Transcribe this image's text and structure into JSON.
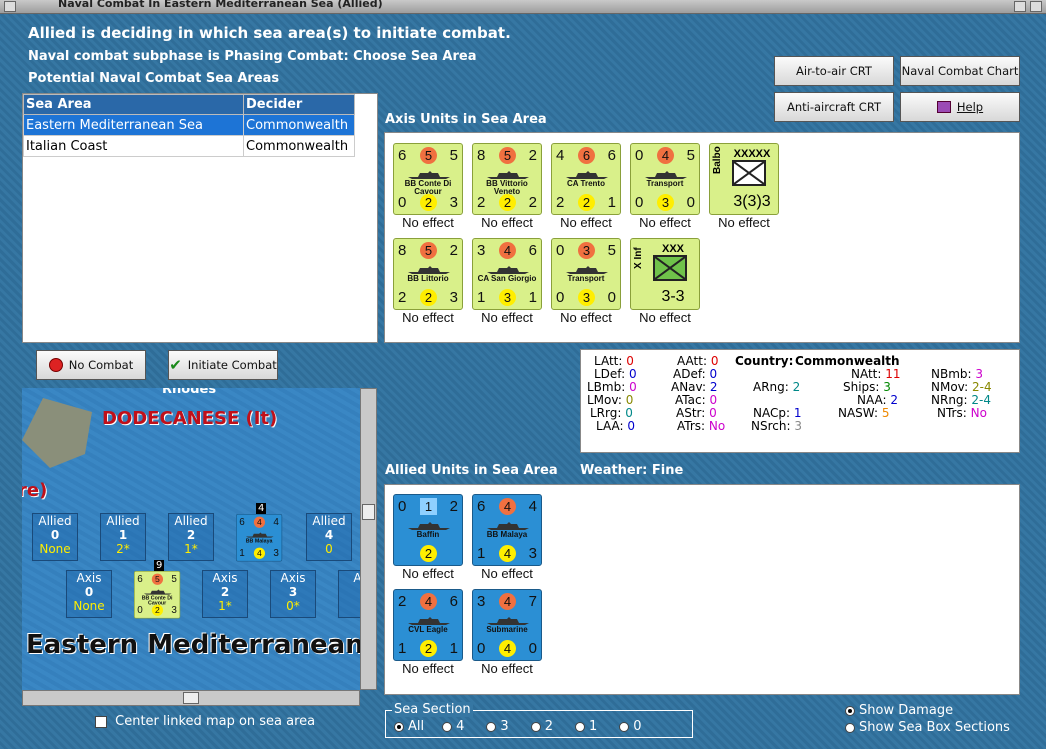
{
  "window": {
    "title": "Naval Combat In Eastern Mediterranean Sea (Allied)"
  },
  "messages": {
    "line1": "Allied is deciding in which sea area(s) to initiate combat.",
    "line2": "Naval combat subphase is Phasing Combat: Choose Sea Area",
    "line3": "Potential Naval Combat Sea Areas"
  },
  "sea_table": {
    "headers": [
      "Sea Area",
      "Decider"
    ],
    "rows": [
      {
        "area": "Eastern Mediterranean Sea",
        "decider": "Commonwealth"
      },
      {
        "area": "Italian Coast",
        "decider": "Commonwealth"
      }
    ]
  },
  "buttons": {
    "air_to_air": "Air-to-air CRT",
    "naval_chart": "Naval Combat Chart",
    "anti_aircraft": "Anti-aircraft CRT",
    "help": "Help",
    "no_combat": "No Combat",
    "initiate": "Initiate Combat"
  },
  "axis_section": {
    "label": "Axis Units in Sea Area"
  },
  "allied_section": {
    "label": "Allied Units in Sea Area",
    "weather": "Weather:  Fine"
  },
  "axis_units": [
    {
      "tl": "6",
      "red": "5",
      "tr": "5",
      "name": "BB Conte Di Cavour",
      "bl": "0",
      "yel": "2",
      "br": "3",
      "effect": "No effect"
    },
    {
      "tl": "8",
      "red": "5",
      "tr": "2",
      "name": "BB Vittorio Veneto",
      "bl": "2",
      "yel": "2",
      "br": "2",
      "effect": "No effect"
    },
    {
      "tl": "4",
      "red": "6",
      "tr": "6",
      "name": "CA Trento",
      "bl": "2",
      "yel": "2",
      "br": "1",
      "effect": "No effect"
    },
    {
      "tl": "0",
      "red": "4",
      "tr": "5",
      "name": "Transport",
      "bl": "0",
      "yel": "3",
      "br": "0",
      "effect": "No effect"
    },
    {
      "top": "XXXXX",
      "side": "Balbo",
      "val": "3(3)3",
      "effect": "No effect"
    },
    {
      "tl": "8",
      "red": "5",
      "tr": "2",
      "name": "BB Littorio",
      "bl": "2",
      "yel": "2",
      "br": "3",
      "effect": "No effect"
    },
    {
      "tl": "3",
      "red": "4",
      "tr": "6",
      "name": "CA San Giorgio",
      "bl": "1",
      "yel": "3",
      "br": "1",
      "effect": "No effect"
    },
    {
      "tl": "0",
      "red": "3",
      "tr": "5",
      "name": "Transport",
      "bl": "0",
      "yel": "3",
      "br": "0",
      "effect": "No effect"
    },
    {
      "top": "XXX",
      "side": "X Inf",
      "val": "3-3",
      "effect": "No effect"
    }
  ],
  "allied_units": [
    {
      "tl": "0",
      "blue": "1",
      "tr": "2",
      "name": "Baffin",
      "yel": "2",
      "effect": "No effect"
    },
    {
      "tl": "6",
      "red": "4",
      "tr": "4",
      "name": "BB Malaya",
      "bl": "1",
      "yel": "4",
      "br": "3",
      "effect": "No effect"
    },
    {
      "tl": "2",
      "red": "4",
      "tr": "6",
      "name": "CVL Eagle",
      "bl": "1",
      "yel": "2",
      "br": "1",
      "effect": "No effect"
    },
    {
      "tl": "3",
      "red": "4",
      "tr": "7",
      "name": "Submarine",
      "bl": "0",
      "yel": "4",
      "br": "0",
      "effect": "No effect"
    }
  ],
  "stats": {
    "LAtt": "0",
    "LDef": "0",
    "LBmb": "0",
    "LMov": "0",
    "LRrg": "0",
    "LAA": "0",
    "AAtt": "0",
    "ADef": "0",
    "ANav": "2",
    "ATac": "0",
    "AStr": "0",
    "ATrs": "No",
    "country_label": "Country:",
    "country": "Commonwealth",
    "ARng": "2",
    "NACp": "1",
    "NSrch": "3",
    "NAtt": "11",
    "Ships": "3",
    "NAA": "2",
    "NASW": "5",
    "NBmb": "3",
    "NMov": "2-4",
    "NRng": "2-4",
    "NTrs": "No"
  },
  "map": {
    "place1": "Rhodes",
    "place2": "DODECANESE (It)",
    "place3": "re)",
    "sea_name": "Eastern Mediterranean",
    "allied_boxes": [
      {
        "label": "Allied",
        "num": "0",
        "val": "None"
      },
      {
        "label": "Allied",
        "num": "1",
        "val": "2*"
      },
      {
        "label": "Allied",
        "num": "2",
        "val": "1*"
      },
      {
        "label": "Allied",
        "num": "4",
        "val": "0"
      }
    ],
    "axis_boxes": [
      {
        "label": "Axis",
        "num": "0",
        "val": "None"
      },
      {
        "label": "Axis",
        "num": "2",
        "val": "1*"
      },
      {
        "label": "Axis",
        "num": "3",
        "val": "0*"
      },
      {
        "label": "Ax",
        "num": "",
        "val": ""
      }
    ],
    "stack_badge_1": "4",
    "stack_badge_2": "9",
    "map_counter_1": {
      "tl": "6",
      "red": "4",
      "tr": "4",
      "name": "BB Malaya",
      "bl": "1",
      "yel": "4",
      "br": "3"
    },
    "map_counter_2": {
      "tl": "6",
      "red": "5",
      "tr": "5",
      "name": "BB Conte Di Cavour",
      "bl": "0",
      "yel": "2",
      "br": "3"
    }
  },
  "center_linked": "Center linked map on sea area",
  "sea_section": {
    "label": "Sea Section",
    "options": [
      "All",
      "4",
      "3",
      "2",
      "1",
      "0"
    ],
    "selected": "All"
  },
  "display_options": {
    "show_damage": "Show Damage",
    "show_boxes": "Show Sea Box Sections",
    "selected": "show_damage"
  }
}
